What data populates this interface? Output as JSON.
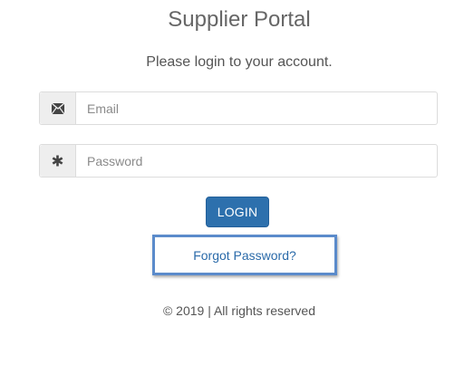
{
  "title": "Supplier Portal",
  "subtitle": "Please login to your account.",
  "email": {
    "icon": "envelope-icon",
    "placeholder": "Email",
    "value": ""
  },
  "password": {
    "icon": "asterisk-icon",
    "placeholder": "Password",
    "value": ""
  },
  "login_button": "LOGIN",
  "forgot_password": "Forgot Password?",
  "footer": "© 2019 | All rights reserved",
  "colors": {
    "primary": "#2d70ad",
    "link": "#2a6aa9",
    "highlight_border": "#5b8bcb"
  }
}
